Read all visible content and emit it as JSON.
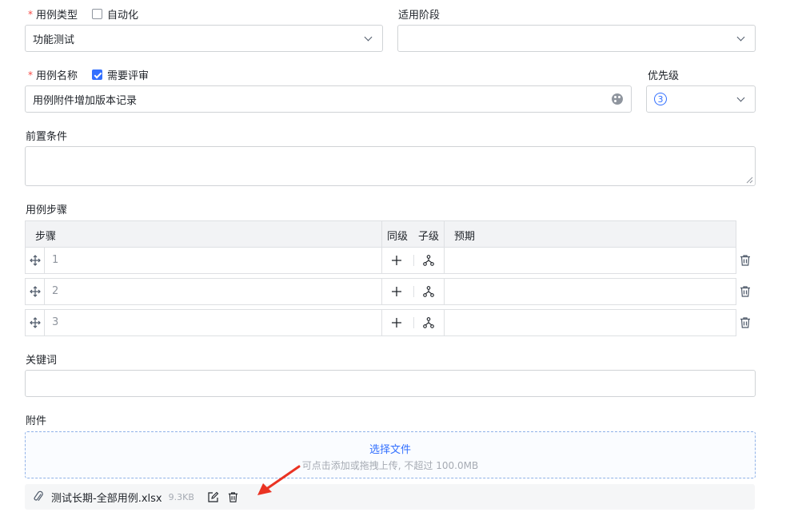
{
  "case_type": {
    "label": "用例类型",
    "automation_label": "自动化",
    "value": "功能测试"
  },
  "stage": {
    "label": "适用阶段",
    "value": ""
  },
  "case_name": {
    "label": "用例名称",
    "review_label": "需要评审",
    "value": "用例附件增加版本记录"
  },
  "priority": {
    "label": "优先级",
    "value": "③"
  },
  "precondition": {
    "label": "前置条件",
    "value": ""
  },
  "steps": {
    "label": "用例步骤",
    "headers": {
      "step": "步骤",
      "sibling": "同级",
      "child": "子级",
      "expected": "预期"
    },
    "rows": [
      {
        "number": "1",
        "expected": ""
      },
      {
        "number": "2",
        "expected": ""
      },
      {
        "number": "3",
        "expected": ""
      }
    ]
  },
  "keywords": {
    "label": "关键词",
    "value": ""
  },
  "attachments": {
    "label": "附件",
    "upload_title": "选择文件",
    "upload_hint": "可点击添加或拖拽上传, 不超过 100.0MB",
    "file_name": "测试长期-全部用例.xlsx",
    "file_size": "9.3KB"
  },
  "colors": {
    "accent": "#3370ff",
    "required": "#f54a45",
    "annotation_arrow": "#ea3323"
  }
}
